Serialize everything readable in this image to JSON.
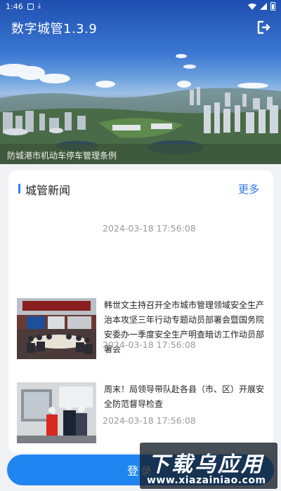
{
  "status_bar": {
    "time": "1:46",
    "icons": [
      "app-notification-icon",
      "download-icon",
      "wifi-icon",
      "signal-icon",
      "battery-icon"
    ]
  },
  "header": {
    "title": "数字城管1.3.9",
    "logout_icon": "logout-icon"
  },
  "banner": {
    "caption": "防城港市机动车停车管理条例"
  },
  "news_section": {
    "title": "城管新闻",
    "more_label": "更多",
    "items": [
      {
        "title": "",
        "time": "2024-03-18 17:56:08",
        "has_image": false
      },
      {
        "title": "韩世文主持召开全市城市管理领域安全生产治本攻坚三年行动专题动员部署会暨国务院安委办一季度安全生产明查暗访工作动员部署会",
        "time": "2024-03-18 17:56:08",
        "has_image": true
      },
      {
        "title": "周末！局领导带队赴各县（市、区）开展安全防范督导检查",
        "time": "2024-03-18 17:56:08",
        "has_image": true
      }
    ]
  },
  "login": {
    "label": "登录"
  },
  "watermark": {
    "main": "下载乌应用",
    "url": "www.xiazainiao.com"
  },
  "colors": {
    "accent": "#2f80ed",
    "login_button": "#1f86f1",
    "more_link": "#2d78e6",
    "time_text": "#9a9a9a"
  }
}
